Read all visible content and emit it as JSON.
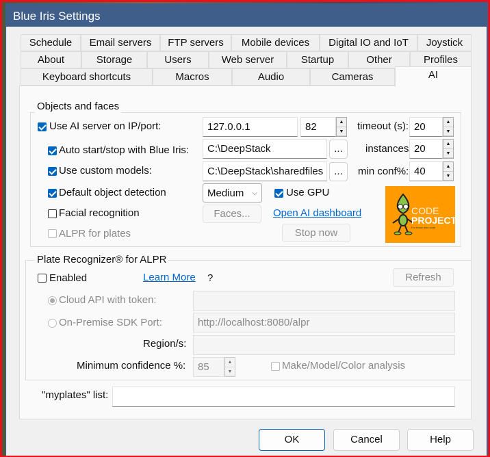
{
  "window": {
    "title": "Blue Iris Settings"
  },
  "tabs": {
    "row1": [
      "Schedule",
      "Email servers",
      "FTP servers",
      "Mobile devices",
      "Digital IO and IoT",
      "Joystick"
    ],
    "row2": [
      "About",
      "Storage",
      "Users",
      "Web server",
      "Startup",
      "Other",
      "Profiles"
    ],
    "row3": [
      "Keyboard shortcuts",
      "Macros",
      "Audio",
      "Cameras",
      "AI"
    ],
    "selected": "AI"
  },
  "objects": {
    "group_label": "Objects and faces",
    "use_ai_server": {
      "label": "Use AI server on IP/port:",
      "checked": true
    },
    "ip": "127.0.0.1",
    "port": "82",
    "timeout_label": "timeout (s):",
    "timeout": "20",
    "auto_start": {
      "label": "Auto start/stop with Blue Iris:",
      "checked": true
    },
    "path": "C:\\DeepStack",
    "browse": "...",
    "instances_label": "instances:",
    "instances": "20",
    "custom_models": {
      "label": "Use custom models:",
      "checked": true
    },
    "models_path": "C:\\DeepStack\\sharedfiles",
    "min_conf_label": "min conf%:",
    "min_conf": "40",
    "default_detection": {
      "label": "Default object detection",
      "checked": true
    },
    "detection_mode": "Medium",
    "use_gpu": {
      "label": "Use GPU",
      "checked": true
    },
    "facial": {
      "label": "Facial recognition",
      "checked": false
    },
    "faces_button": "Faces...",
    "dashboard_link": "Open AI dashboard",
    "alpr": {
      "label": "ALPR for plates",
      "checked": false
    },
    "stop_button": "Stop now",
    "logo": {
      "line1": "CODE",
      "line2": "PROJECT",
      "tagline": "For those who code",
      "color": "#ff9a00"
    }
  },
  "plate": {
    "group_label": "Plate Recognizer® for ALPR",
    "enabled": {
      "label": "Enabled",
      "checked": false
    },
    "learn_more": "Learn More",
    "help": "?",
    "refresh": "Refresh",
    "cloud": {
      "label": "Cloud API with token:",
      "selected": true,
      "value": ""
    },
    "onprem": {
      "label": "On-Premise SDK Port:",
      "selected": false,
      "value": "http://localhost:8080/alpr"
    },
    "region_label": "Region/s:",
    "region": "",
    "min_conf_label": "Minimum confidence %:",
    "min_conf": "85",
    "mmc": {
      "label": "Make/Model/Color analysis",
      "checked": false
    }
  },
  "myplates": {
    "label": "\"myplates\" list:",
    "value": ""
  },
  "buttons": {
    "ok": "OK",
    "cancel": "Cancel",
    "help": "Help"
  }
}
